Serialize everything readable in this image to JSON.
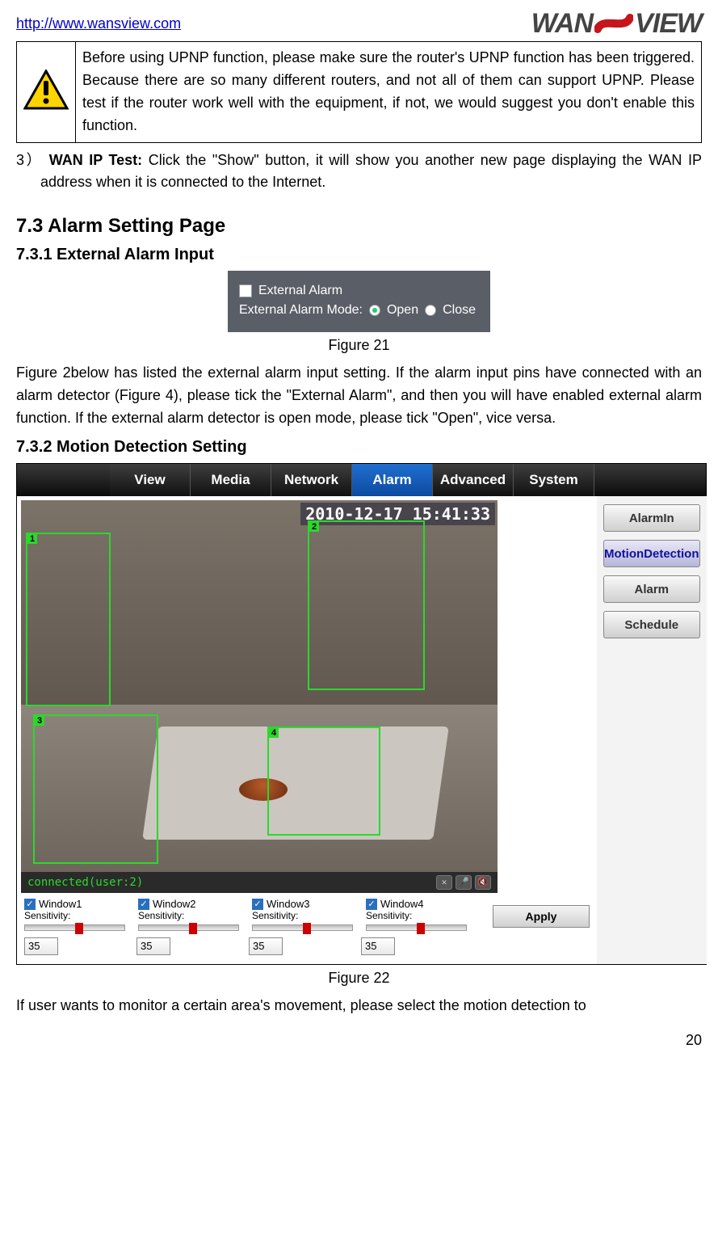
{
  "header": {
    "url": "http://www.wansview.com",
    "logo_pre": "WAN",
    "logo_post": "VIEW"
  },
  "warning_box": {
    "text": "Before using UPNP function, please make sure the router's UPNP function has been triggered. Because there are so many different routers, and not all of them can support UPNP. Please test if the router work well with the equipment, if not, we would suggest you don't enable this function."
  },
  "item3": {
    "num": "3）",
    "bold": "WAN IP Test:",
    "rest": " Click the \"Show\" button, it will show you another new page displaying the WAN IP address when it is connected to the Internet."
  },
  "sec73": {
    "heading": "7.3  Alarm Setting Page",
    "sub731": "7.3.1  External Alarm Input",
    "fig21": {
      "external_label": "External Alarm",
      "mode_label": "External Alarm Mode:",
      "open": "Open",
      "close": "Close"
    },
    "fig21_caption": "Figure 21",
    "para731": "Figure 2below has listed the external alarm input setting. If the alarm input pins have connected with an alarm detector (Figure 4), please tick the \"External Alarm\", and then you will have enabled external alarm function. If the external alarm detector is open mode, please tick \"Open\", vice versa.",
    "sub732": "7.3.2  Motion Detection Setting"
  },
  "fig22": {
    "tabs": [
      "View",
      "Media",
      "Network",
      "Alarm",
      "Advanced",
      "System"
    ],
    "active_tab_index": 3,
    "timestamp": "2010-12-17 15:41:33",
    "status": "connected(user:2)",
    "side": [
      {
        "label": "AlarmIn",
        "active": false
      },
      {
        "label": "MotionDetection",
        "active": true
      },
      {
        "label": "Alarm",
        "active": false
      },
      {
        "label": "Schedule",
        "active": false
      }
    ],
    "zones": [
      "1",
      "2",
      "3",
      "4"
    ],
    "windows": [
      {
        "name": "Window1",
        "sens_label": "Sensitivity:",
        "value": "35"
      },
      {
        "name": "Window2",
        "sens_label": "Sensitivity:",
        "value": "35"
      },
      {
        "name": "Window3",
        "sens_label": "Sensitivity:",
        "value": "35"
      },
      {
        "name": "Window4",
        "sens_label": "Sensitivity:",
        "value": "35"
      }
    ],
    "apply": "Apply",
    "caption": "Figure 22"
  },
  "trailing_para": "If user wants to monitor a certain area's movement, please select the motion detection to",
  "page_number": "20"
}
